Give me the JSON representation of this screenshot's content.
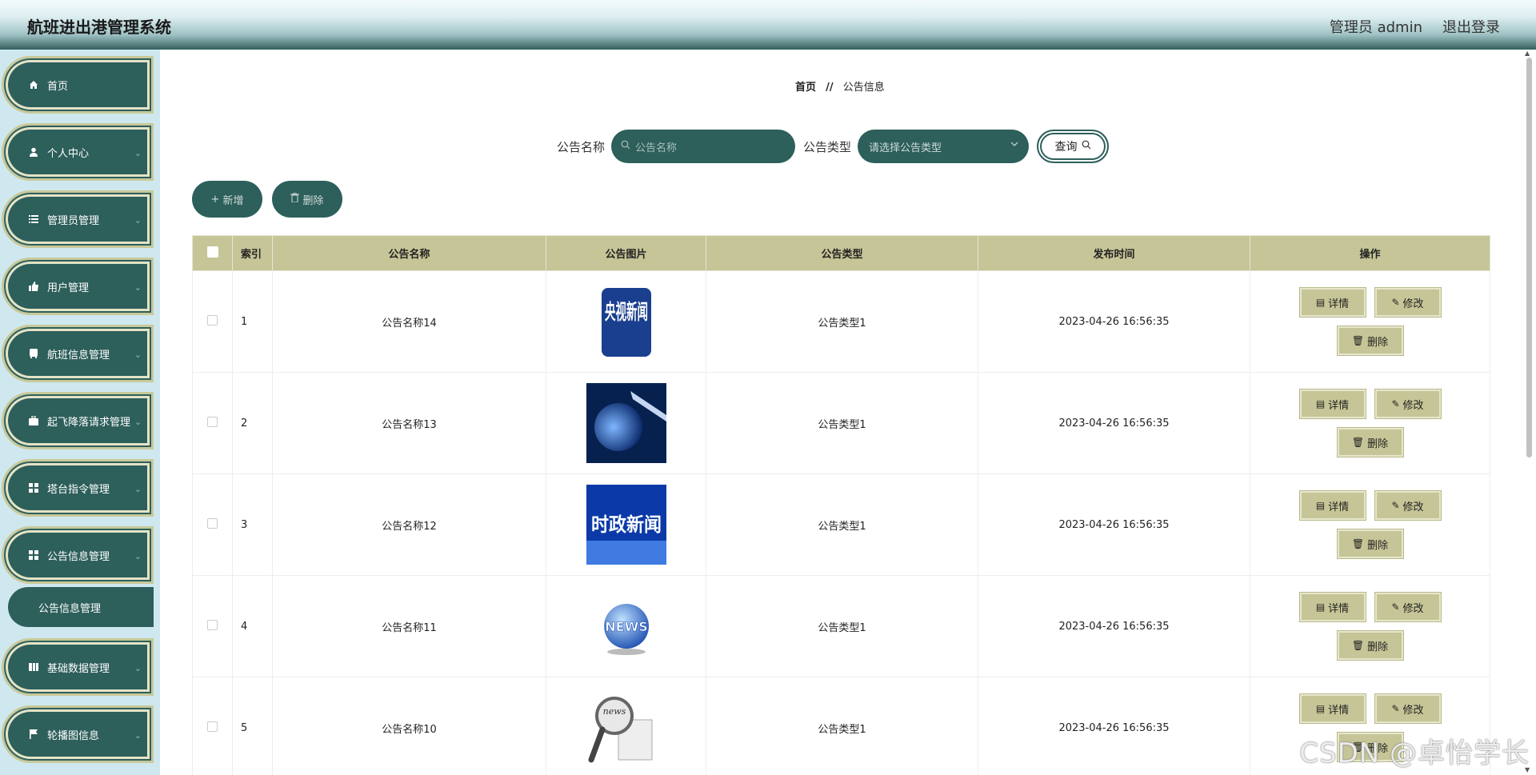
{
  "header": {
    "title": "航班进出港管理系统",
    "admin": "管理员 admin",
    "logout": "退出登录"
  },
  "sidebar": {
    "items": [
      {
        "label": "首页",
        "icon": "home-icon"
      },
      {
        "label": "个人中心",
        "icon": "user-icon"
      },
      {
        "label": "管理员管理",
        "icon": "list-icon"
      },
      {
        "label": "用户管理",
        "icon": "thumb-icon"
      },
      {
        "label": "航班信息管理",
        "icon": "bus-icon"
      },
      {
        "label": "起飞降落请求管理",
        "icon": "briefcase-icon"
      },
      {
        "label": "塔台指令管理",
        "icon": "grid-icon"
      },
      {
        "label": "公告信息管理",
        "icon": "grid-icon"
      },
      {
        "label": "基础数据管理",
        "icon": "book-icon"
      },
      {
        "label": "轮播图信息",
        "icon": "flag-icon"
      }
    ],
    "submenu": "公告信息管理"
  },
  "breadcrumb": {
    "home": "首页",
    "sep": "//",
    "current": "公告信息"
  },
  "search": {
    "name_label": "公告名称",
    "name_placeholder": "公告名称",
    "type_label": "公告类型",
    "type_placeholder": "请选择公告类型",
    "query_button": "查询"
  },
  "actions": {
    "add": "新增",
    "delete": "删除"
  },
  "table": {
    "headers": [
      "索引",
      "公告名称",
      "公告图片",
      "公告类型",
      "发布时间",
      "操作"
    ],
    "rows": [
      {
        "index": "1",
        "name": "公告名称14",
        "image_caption": "央视新闻",
        "type": "公告类型1",
        "time": "2023-04-26 16:56:35"
      },
      {
        "index": "2",
        "name": "公告名称13",
        "image_caption": "",
        "type": "公告类型1",
        "time": "2023-04-26 16:56:35"
      },
      {
        "index": "3",
        "name": "公告名称12",
        "image_caption": "时政新闻",
        "type": "公告类型1",
        "time": "2023-04-26 16:56:35"
      },
      {
        "index": "4",
        "name": "公告名称11",
        "image_caption": "NEWS",
        "type": "公告类型1",
        "time": "2023-04-26 16:56:35"
      },
      {
        "index": "5",
        "name": "公告名称10",
        "image_caption": "news",
        "type": "公告类型1",
        "time": "2023-04-26 16:56:35"
      }
    ],
    "op_labels": {
      "detail": "详情",
      "edit": "修改",
      "delete": "删除"
    }
  },
  "colors": {
    "primary": "#2d5f5b",
    "table_header": "#c5c597",
    "sidebar_bg": "#cfe8ef"
  },
  "watermark": "CSDN @卓怡学长"
}
